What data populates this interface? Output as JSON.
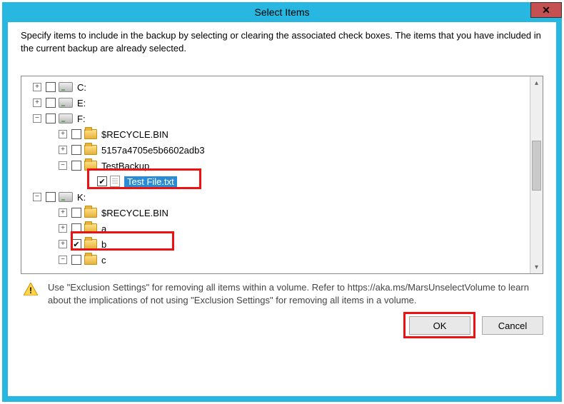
{
  "window": {
    "title": "Select Items",
    "close_glyph": "✕"
  },
  "instructions": "Specify items to include in the backup by selecting or clearing the associated check boxes. The items that you have included in the current backup are already selected.",
  "tree": {
    "rows": [
      {
        "indent": 0,
        "expand": "+",
        "checked": false,
        "icon": "drive",
        "label": "C:",
        "selected": false
      },
      {
        "indent": 0,
        "expand": "+",
        "checked": false,
        "icon": "drive",
        "label": "E:",
        "selected": false
      },
      {
        "indent": 0,
        "expand": "-",
        "checked": false,
        "icon": "drive",
        "label": "F:",
        "selected": false
      },
      {
        "indent": 1,
        "expand": "+",
        "checked": false,
        "icon": "folder",
        "label": "$RECYCLE.BIN",
        "selected": false
      },
      {
        "indent": 1,
        "expand": "+",
        "checked": false,
        "icon": "folder",
        "label": "5157a4705e5b6602adb3",
        "selected": false
      },
      {
        "indent": 1,
        "expand": "-",
        "checked": false,
        "icon": "folder",
        "label": "TestBackup",
        "selected": false
      },
      {
        "indent": 2,
        "expand": "",
        "checked": true,
        "icon": "file",
        "label": "Test File.txt",
        "selected": true
      },
      {
        "indent": 0,
        "expand": "-",
        "checked": false,
        "icon": "drive",
        "label": "K:",
        "selected": false
      },
      {
        "indent": 1,
        "expand": "+",
        "checked": false,
        "icon": "folder",
        "label": "$RECYCLE.BIN",
        "selected": false
      },
      {
        "indent": 1,
        "expand": "+",
        "checked": false,
        "icon": "folder",
        "label": "a",
        "selected": false
      },
      {
        "indent": 1,
        "expand": "+",
        "checked": true,
        "icon": "folder",
        "label": "b",
        "selected": false
      },
      {
        "indent": 1,
        "expand": "-",
        "checked": false,
        "icon": "folder",
        "label": "c",
        "selected": false
      }
    ]
  },
  "note_text": "Use \"Exclusion Settings\" for removing all items within a volume. Refer to https://aka.ms/MarsUnselectVolume to learn about the implications of not using \"Exclusion Settings\" for removing all items in a volume.",
  "buttons": {
    "ok": "OK",
    "cancel": "Cancel"
  }
}
